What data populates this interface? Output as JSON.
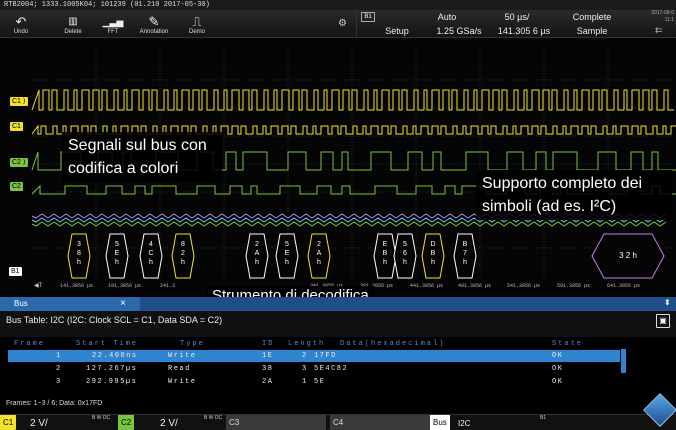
{
  "window": {
    "title": "RTB2004; 1333.1005K04; 101239 (01.210 2017-05-30)"
  },
  "toolbar": {
    "buttons": [
      {
        "label": "Undo",
        "icon": "undo-icon",
        "glyph": "↶"
      },
      {
        "label": "Delete",
        "icon": "trash-icon",
        "glyph": "🗑"
      },
      {
        "label": "FFT",
        "icon": "spectrum-icon",
        "glyph": "▁▃▅"
      },
      {
        "label": "Annotation",
        "icon": "pen-icon",
        "glyph": "✎"
      },
      {
        "label": "Demo",
        "icon": "demo-icon",
        "glyph": "⎍"
      }
    ]
  },
  "info": {
    "bus_tag": "B1",
    "trigger_mode": "Auto",
    "time_scale": "50 µs/",
    "acq_state": "Complete",
    "setup_label": "Setup",
    "sample_rate": "1.25 GSa/s",
    "trigger_pos": "141.305 6 µs",
    "acq_mode": "Sample",
    "date": "2017-09-0",
    "time": "11:1"
  },
  "channels": [
    {
      "tag": "C1",
      "color": "#f2e22a"
    },
    {
      "tag": "C1",
      "color": "#f2e22a"
    },
    {
      "tag": "C2",
      "color": "#79c440"
    },
    {
      "tag": "C2",
      "color": "#79c440"
    },
    {
      "tag": "B1",
      "color": "#ffffff"
    }
  ],
  "callouts": {
    "bus_colors": "Segnali sul bus con codifica a colori",
    "symbols": "Supporto completo dei simboli (ad es. I²C)",
    "decoder": "Strumento di decodifica"
  },
  "decode_blocks": [
    [
      "3",
      "8",
      "h"
    ],
    [
      "5",
      "E",
      "h"
    ],
    [
      "4",
      "C",
      "h"
    ],
    [
      "8",
      "2",
      "h"
    ],
    [
      "2",
      "A",
      "h"
    ],
    [
      "5",
      "E",
      "h"
    ],
    [
      "2",
      "A",
      "h"
    ],
    [
      "E",
      "B",
      "h"
    ],
    [
      "5",
      "6",
      "h"
    ],
    [
      "D",
      "B",
      "h"
    ],
    [
      "B",
      "7",
      "h"
    ]
  ],
  "symbol_block": "3 2 h",
  "time_labels": [
    "141.3056 µs",
    "191.3056 µs",
    "241.3",
    "341.3056 µs",
    "391.3056 µs",
    "441.3056 µs",
    "491.3056 µs",
    "541.3056 µs",
    "591.3056 µs",
    "641.3056 µs"
  ],
  "bus_window": {
    "tab_label": "Bus",
    "close_glyph": "×",
    "title": "Bus Table: I2C (I2C: Clock SCL = C1, Data SDA = C2)",
    "columns": [
      "Frame",
      "Start Time",
      "Type",
      "ID",
      "Length",
      "Data(hexadecimal)",
      "State"
    ],
    "rows": [
      {
        "frame": "1",
        "start": "22.400ns",
        "type": "Write",
        "id": "1E",
        "length": "2",
        "data": "17FD",
        "state": "OK"
      },
      {
        "frame": "2",
        "start": "127.267µs",
        "type": "Read",
        "id": "38",
        "length": "3",
        "data": "5E4C82",
        "state": "OK"
      },
      {
        "frame": "3",
        "start": "292.995µs",
        "type": "Write",
        "id": "2A",
        "length": "1",
        "data": "5E",
        "state": "OK"
      }
    ],
    "frames_info": "Frames: 1−3 / 6; Data: 0x17FD"
  },
  "status_bar": {
    "c1": {
      "tag": "C1",
      "value": "2 V/",
      "sup": "B W DC",
      "color": "#f2e22a"
    },
    "c2": {
      "tag": "C2",
      "value": "2 V/",
      "sup": "B W DC",
      "color": "#79c440"
    },
    "c3": {
      "tag": "C3"
    },
    "c4": {
      "tag": "C4"
    },
    "bus": {
      "tag": "Bus",
      "value": "I2C",
      "sup": "B1"
    }
  },
  "trigger_marker": "T"
}
